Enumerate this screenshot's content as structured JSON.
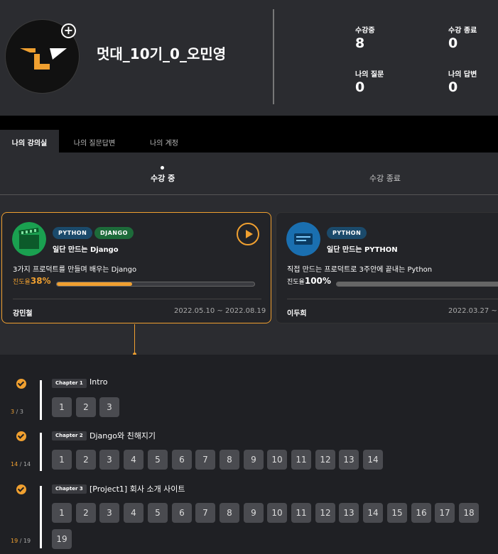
{
  "profile": {
    "username": "멋대_10기_0_오민영",
    "add_icon": "plus-circle-icon",
    "stats": [
      {
        "label": "수강중",
        "value": "8"
      },
      {
        "label": "수강 종료",
        "value": "0"
      },
      {
        "label": "나의 질문",
        "value": "0"
      },
      {
        "label": "나의 답변",
        "value": "0"
      }
    ]
  },
  "tabs": [
    "나의 강의실",
    "나의 질문답변",
    "나의 계정"
  ],
  "subtabs": [
    "수강 중",
    "수강 종료"
  ],
  "courses": [
    {
      "badges": [
        "PYTHON",
        "DJANGO"
      ],
      "title": "일단 만드는 Django",
      "desc": "3가지 프로덕트를 만들며 배우는 Django",
      "progress_label": "진도율",
      "progress_text": "38%",
      "progress": 0.38,
      "teacher": "강민철",
      "period": "2022.05.10 ~ 2022.08.19"
    },
    {
      "badges": [
        "PYTHON"
      ],
      "title": "일단 만드는 PYTHON",
      "desc": "직접 만드는 프로덕트로 3주안에 끝내는 Python",
      "progress_label": "진도율",
      "progress_text": "100%",
      "progress": 1.0,
      "teacher": "이두희",
      "period": "2022.03.27 ~ 2"
    }
  ],
  "chapters": [
    {
      "badge": "Chapter 1",
      "title": "Intro",
      "done": "3",
      "total": "3",
      "lessons": [
        "1",
        "2",
        "3"
      ]
    },
    {
      "badge": "Chapter 2",
      "title": "Django와 친해지기",
      "done": "14",
      "total": "14",
      "lessons": [
        "1",
        "2",
        "3",
        "4",
        "5",
        "6",
        "7",
        "8",
        "9",
        "10",
        "11",
        "12",
        "13",
        "14"
      ]
    },
    {
      "badge": "Chapter 3",
      "title": "[Project1] 회사 소개 사이트",
      "done": "19",
      "total": "19",
      "lessons": [
        "1",
        "2",
        "3",
        "4",
        "5",
        "6",
        "7",
        "8",
        "9",
        "10",
        "11",
        "12",
        "13",
        "14",
        "15",
        "16",
        "17",
        "18",
        "19"
      ]
    }
  ],
  "colors": {
    "accent": "#f0a030",
    "python_badge": "#1b4a6b",
    "django_badge": "#1d6b3a"
  }
}
